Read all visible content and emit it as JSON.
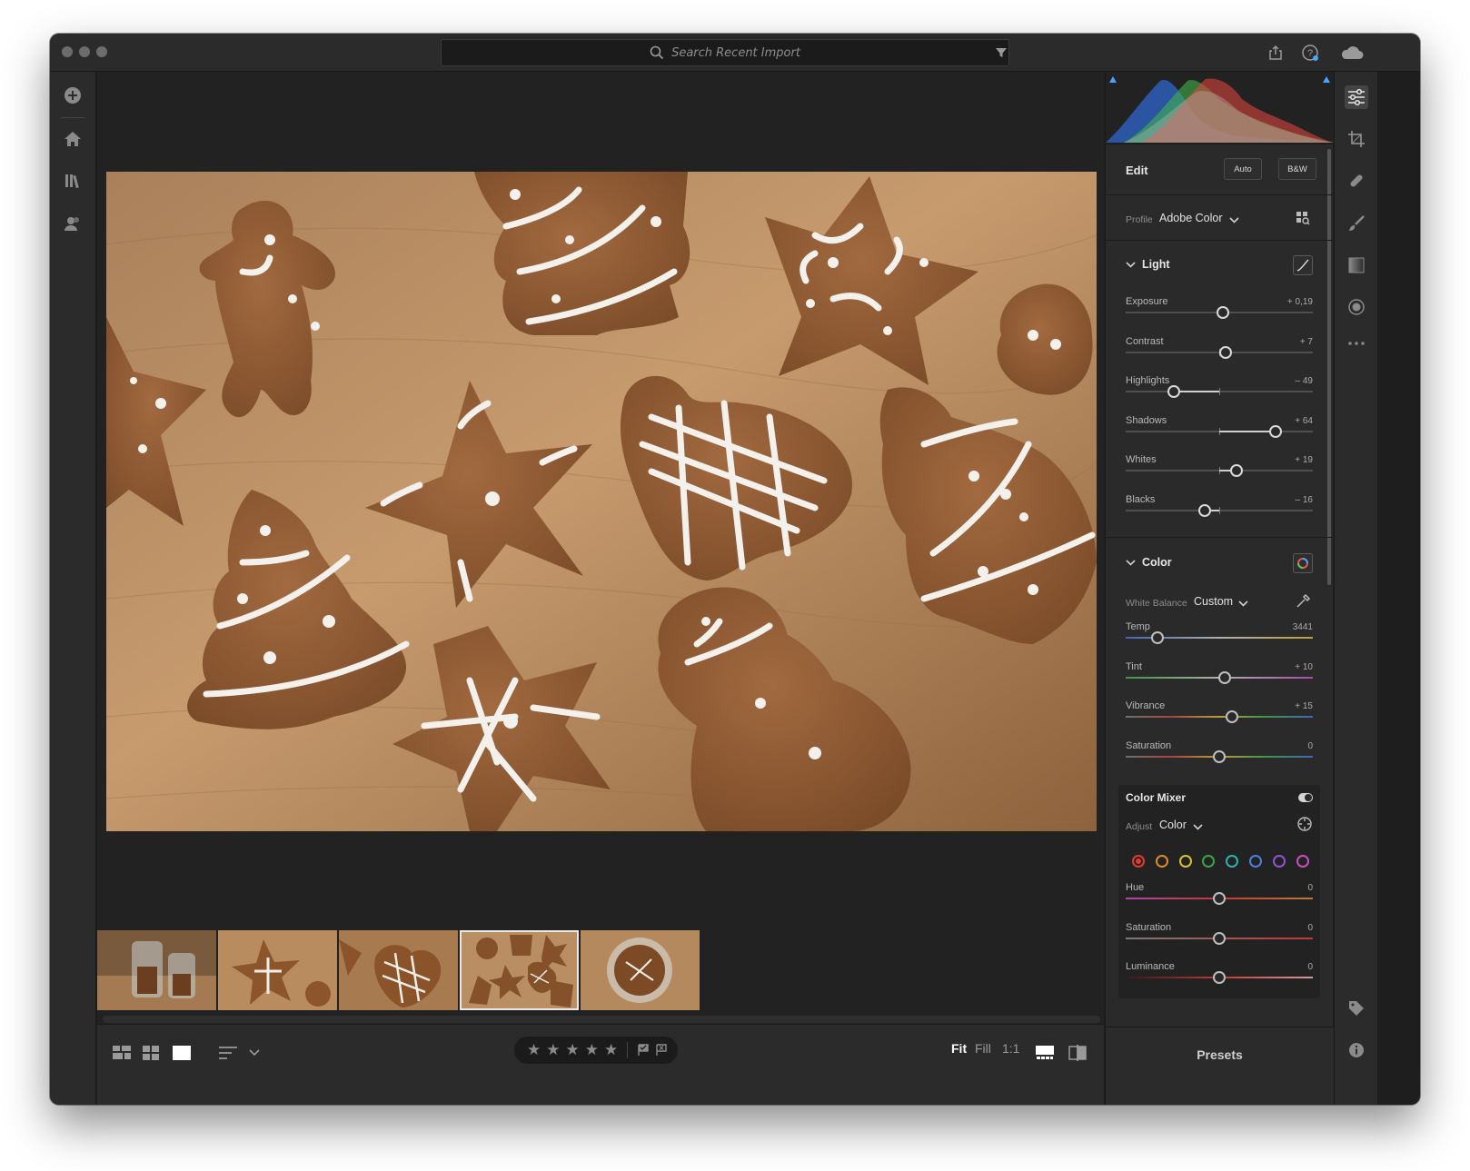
{
  "search": {
    "placeholder": "Search Recent Import"
  },
  "edit": {
    "title": "Edit",
    "auto_label": "Auto",
    "bw_label": "B&W",
    "profile_label": "Profile",
    "profile_value": "Adobe Color"
  },
  "light": {
    "title": "Light",
    "sliders": [
      {
        "label": "Exposure",
        "value": "+ 0,19",
        "position": 0.52
      },
      {
        "label": "Contrast",
        "value": "+ 7",
        "position": 0.535
      },
      {
        "label": "Highlights",
        "value": "– 49",
        "position": 0.255
      },
      {
        "label": "Shadows",
        "value": "+ 64",
        "position": 0.8
      },
      {
        "label": "Whites",
        "value": "+ 19",
        "position": 0.59
      },
      {
        "label": "Blacks",
        "value": "– 16",
        "position": 0.42
      }
    ]
  },
  "color": {
    "title": "Color",
    "wb_label": "White Balance",
    "wb_value": "Custom",
    "sliders": [
      {
        "label": "Temp",
        "value": "3441",
        "position": 0.17
      },
      {
        "label": "Tint",
        "value": "+ 10",
        "position": 0.53
      },
      {
        "label": "Vibrance",
        "value": "+ 15",
        "position": 0.57
      },
      {
        "label": "Saturation",
        "value": "0",
        "position": 0.5
      }
    ]
  },
  "mixer": {
    "title": "Color Mixer",
    "adjust_label": "Adjust",
    "adjust_value": "Color",
    "swatches": [
      "#e03c32",
      "#e08a2a",
      "#d8c32e",
      "#35a845",
      "#2fb3b0",
      "#4b7fe0",
      "#8a55d8",
      "#c94fc0"
    ],
    "sliders": [
      {
        "label": "Hue",
        "value": "0",
        "position": 0.5
      },
      {
        "label": "Saturation",
        "value": "0",
        "position": 0.5
      },
      {
        "label": "Luminance",
        "value": "0",
        "position": 0.5
      }
    ]
  },
  "bottombar": {
    "fit": "Fit",
    "fill": "Fill",
    "one_to_one": "1:1",
    "stars": [
      "★",
      "★",
      "★",
      "★",
      "★"
    ]
  },
  "presets_label": "Presets",
  "colors": {
    "window_bg": "#1e1e1e",
    "panel_bg": "#2a2a2a",
    "accent_blue": "#4aa3ff"
  }
}
